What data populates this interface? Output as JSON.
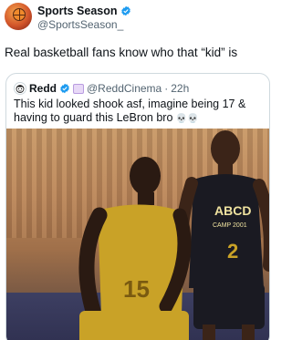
{
  "post": {
    "display_name": "Sports Season",
    "handle": "@SportsSeason_",
    "text": "Real basketball fans know who that “kid” is"
  },
  "quote": {
    "display_name": "Redd",
    "handle": "@ReddCinema",
    "separator": "·",
    "time": "22h",
    "text": "This kid looked shook asf, imagine being 17 & having to guard this LeBron bro",
    "emoji": "💀💀",
    "photo": {
      "left_jersey_number": "15",
      "right_jersey_text": "ABCD",
      "right_jersey_sub": "CAMP 2001",
      "right_jersey_number": "2"
    }
  },
  "colors": {
    "verified": "#1d9bf0",
    "text": "#0f1419",
    "muted": "#536471",
    "border": "#cfd9de",
    "jersey_gold": "#c9a227",
    "jersey_black": "#1a1a22"
  }
}
